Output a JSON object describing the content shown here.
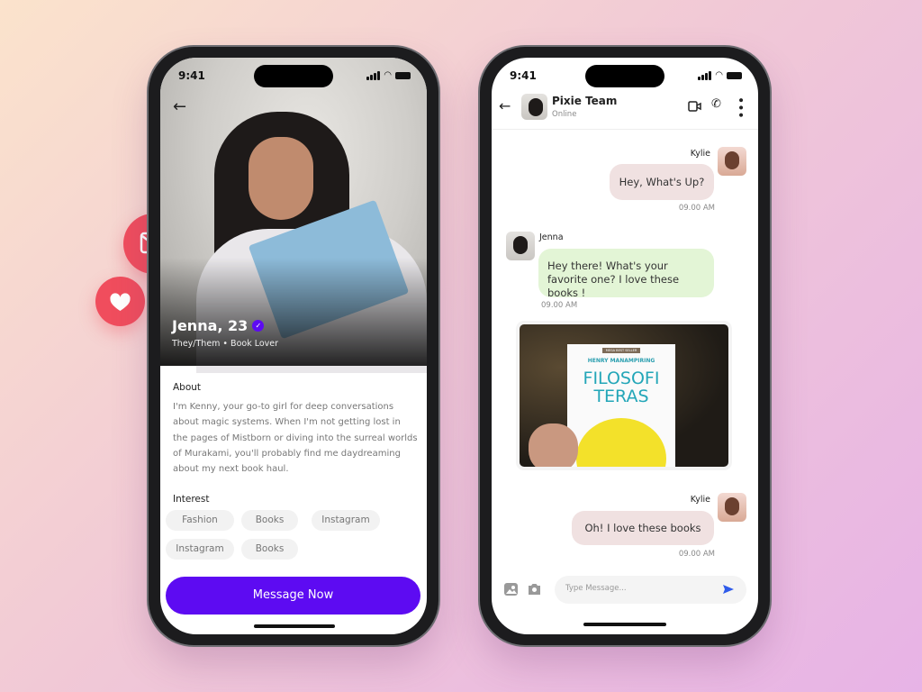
{
  "colors": {
    "accent": "#5d0bf2",
    "floating_badge": "#f04d5d",
    "sent_bubble": "#f0e1e1",
    "received_bubble": "#e3f5d6",
    "send_icon": "#2f5bea"
  },
  "status_bar": {
    "time": "9:41"
  },
  "profile": {
    "name": "Jenna, 23",
    "verified_icon": "verified-check-icon",
    "subtitle": "They/Them • Book Lover",
    "about_title": "About",
    "about_text": "I'm Kenny, your go-to girl for deep conversations about magic systems. When I'm not getting lost in the pages of Mistborn or diving into the surreal worlds of Murakami, you'll probably find me daydreaming about my next book haul.",
    "interest_title": "Interest",
    "interests": [
      "Fashion",
      "Books",
      "Instagram",
      "Instagram",
      "Books"
    ],
    "message_button": "Message Now"
  },
  "chat": {
    "title": "Pixie Team",
    "status": "Online",
    "messages": [
      {
        "sender": "Kylie",
        "text": "Hey, What's Up?",
        "time": "09.00 AM"
      },
      {
        "sender": "Jenna",
        "text": "Hey there! What's your favorite one? I love these books !",
        "time": "09.00 AM"
      },
      {
        "sender": "Jenna",
        "image": {
          "badge": "MEGA BEST SELLER",
          "author": "HENRY MANAMPIRING",
          "title_line1": "FILOSOFI",
          "title_line2": "TERAS"
        }
      },
      {
        "sender": "Kylie",
        "text": "Oh! I love these books",
        "time": "09.00 AM"
      }
    ],
    "input_placeholder": "Type Message..."
  }
}
